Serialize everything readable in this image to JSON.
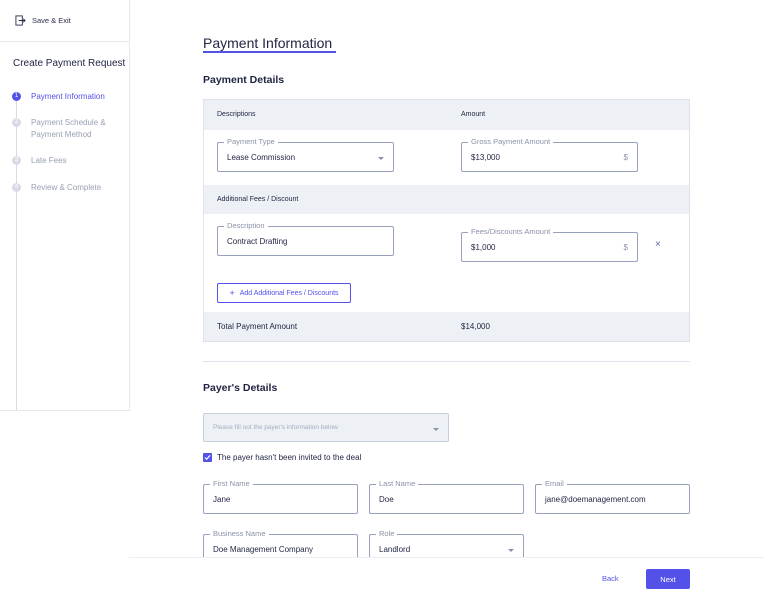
{
  "sidebar": {
    "save_exit": "Save & Exit",
    "title": "Create Payment Request",
    "steps": [
      {
        "num": "1",
        "label": "Payment Information"
      },
      {
        "num": "2",
        "label": "Payment Schedule & Payment Method"
      },
      {
        "num": "3",
        "label": "Late Fees"
      },
      {
        "num": "4",
        "label": "Review & Complete"
      }
    ]
  },
  "page_title": "Payment Information",
  "payment_details": {
    "heading": "Payment Details",
    "col_descriptions": "Descriptions",
    "col_amount": "Amount",
    "payment_type": {
      "label": "Payment Type",
      "value": "Lease Commission"
    },
    "gross_amount": {
      "label": "Gross Payment Amount",
      "value": "$13,000",
      "suffix": "$"
    },
    "fees_header": "Additional Fees / Discount",
    "fee_description": {
      "label": "Description",
      "value": "Contract Drafting"
    },
    "fee_amount": {
      "label": "Fees/Discounts Amount",
      "value": "$1,000",
      "suffix": "$"
    },
    "remove_icon": "×",
    "add_button": "Add Additional Fees / Discounts",
    "add_icon": "+",
    "total_label": "Total Payment Amount",
    "total_value": "$14,000"
  },
  "payer_details": {
    "heading": "Payer's Details",
    "select_placeholder": "Please fill out the payer's information below",
    "not_invited_label": "The payer hasn't been invited to the deal",
    "not_invited_checked": true,
    "first_name": {
      "label": "First Name",
      "value": "Jane"
    },
    "last_name": {
      "label": "Last Name",
      "value": "Doe"
    },
    "email": {
      "label": "Email",
      "value": "jane@doemanagement.com"
    },
    "business_name": {
      "label": "Business Name",
      "value": "Doe Management Company"
    },
    "role": {
      "label": "Role",
      "value": "Landlord"
    }
  },
  "footer": {
    "back": "Back",
    "next": "Next"
  },
  "colors": {
    "accent": "#5451e8",
    "band": "#edf0f5",
    "text": "#1f2340"
  }
}
